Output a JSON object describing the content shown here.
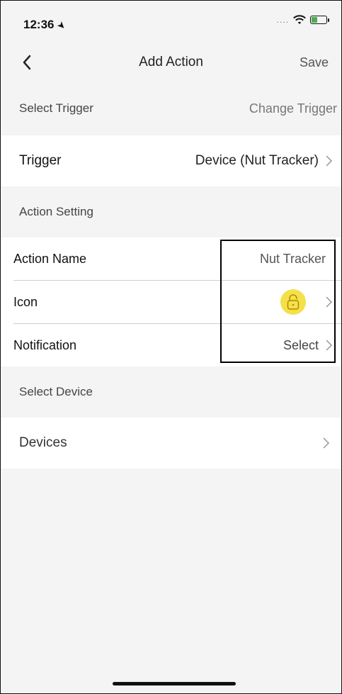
{
  "status_bar": {
    "time": "12:36",
    "location_glyph": "➤",
    "signal": "....",
    "battery_level": 0.4
  },
  "nav": {
    "back_icon": "chevron-left-icon",
    "title": "Add Action",
    "save_label": "Save"
  },
  "sections": {
    "select_trigger": {
      "label": "Select Trigger",
      "action_label": "Change Trigger"
    },
    "trigger_row": {
      "label": "Trigger",
      "value": "Device (Nut Tracker)"
    },
    "action_setting": {
      "label": "Action Setting"
    },
    "action_name_row": {
      "label": "Action Name",
      "value": "Nut Tracker"
    },
    "icon_row": {
      "label": "Icon",
      "icon": "padlock-icon",
      "icon_bg": "#f4e04a"
    },
    "notification_row": {
      "label": "Notification",
      "value": "Select"
    },
    "select_device": {
      "label": "Select Device"
    },
    "devices_row": {
      "label": "Devices"
    }
  }
}
